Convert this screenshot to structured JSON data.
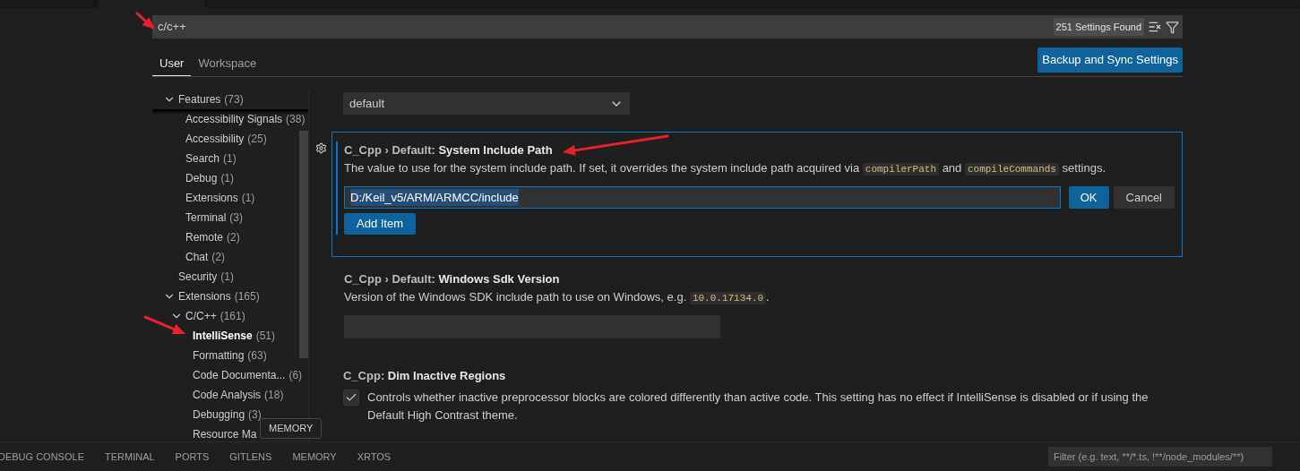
{
  "search": {
    "value": "c/c++",
    "count": "251 Settings Found"
  },
  "tabs": [
    {
      "label": "User",
      "selected": true
    },
    {
      "label": "Workspace",
      "selected": false
    }
  ],
  "sync_button": "Backup and Sync Settings",
  "tree": [
    {
      "label": "Features",
      "count": "(73)",
      "expanded": true,
      "selected": false,
      "children": [
        {
          "label": "Accessibility Signals",
          "count": "(38)",
          "selected": false
        },
        {
          "label": "Accessibility",
          "count": "(25)",
          "selected": false
        },
        {
          "label": "Search",
          "count": "(1)",
          "selected": false
        },
        {
          "label": "Debug",
          "count": "(1)",
          "selected": false
        },
        {
          "label": "Extensions",
          "count": "(1)",
          "selected": false
        },
        {
          "label": "Terminal",
          "count": "(3)",
          "selected": false
        },
        {
          "label": "Remote",
          "count": "(2)",
          "selected": false
        },
        {
          "label": "Chat",
          "count": "(2)",
          "selected": false
        }
      ]
    },
    {
      "label": "Security",
      "count": "(1)",
      "selected": false
    },
    {
      "label": "Extensions",
      "count": "(165)",
      "expanded": true,
      "selected": false,
      "children": [
        {
          "label": "C/C++",
          "count": "(161)",
          "expanded": true,
          "selected": false,
          "children": [
            {
              "label": "IntelliSense",
              "count": "(51)",
              "selected": true
            },
            {
              "label": "Formatting",
              "count": "(63)",
              "selected": false
            },
            {
              "label": "Code Documenta...",
              "count": "(6)",
              "selected": false
            },
            {
              "label": "Code Analysis",
              "count": "(18)",
              "selected": false
            },
            {
              "label": "Debugging",
              "count": "(3)",
              "selected": false
            },
            {
              "label": "Resource Ma",
              "selected": false
            }
          ]
        }
      ]
    }
  ],
  "settings": [
    {
      "kind": "select",
      "value": "default"
    },
    {
      "kind": "list",
      "focused": true,
      "modified": true,
      "category": "C_Cpp › Default: ",
      "name": "System Include Path",
      "description": [
        {
          "kind": "text",
          "text": "The value to use for the system include path. If set, it overrides the system include path acquired via "
        },
        {
          "kind": "code",
          "text": "compilerPath"
        },
        {
          "kind": "text",
          "text": " and "
        },
        {
          "kind": "code",
          "text": "compileCommands"
        },
        {
          "kind": "text",
          "text": " settings."
        }
      ],
      "items": [
        {
          "value": "D:/Keil_v5/ARM/ARMCC/include",
          "text_selected": true
        }
      ],
      "ok": "OK",
      "cancel": "Cancel",
      "add": "Add Item"
    },
    {
      "kind": "text",
      "category": "C_Cpp › Default: ",
      "name": "Windows Sdk Version",
      "description": [
        {
          "kind": "text",
          "text": "Version of the Windows SDK include path to use on Windows, e.g. "
        },
        {
          "kind": "code",
          "text": "10.0.17134.0"
        },
        {
          "kind": "text",
          "text": "."
        }
      ]
    },
    {
      "kind": "checkbox",
      "category": "C_Cpp: ",
      "name": "Dim Inactive Regions",
      "checked": true,
      "description": [
        {
          "kind": "text",
          "text": "Controls whether inactive preprocessor blocks are colored differently than active code. This setting has no effect if IntelliSense is disabled or if using the Default High Contrast theme."
        }
      ]
    }
  ],
  "panel_tabs": [
    {
      "label": "DEBUG CONSOLE",
      "selected": false
    },
    {
      "label": "TERMINAL",
      "selected": false
    },
    {
      "label": "PORTS",
      "selected": false
    },
    {
      "label": "GITLENS",
      "selected": false
    },
    {
      "label": "MEMORY",
      "selected": false
    },
    {
      "label": "XRTOS",
      "selected": false
    }
  ],
  "tooltip": "MEMORY",
  "filter": {
    "placeholder": "Filter (e.g. text, **/*.ts, !**/node_modules/**)"
  }
}
